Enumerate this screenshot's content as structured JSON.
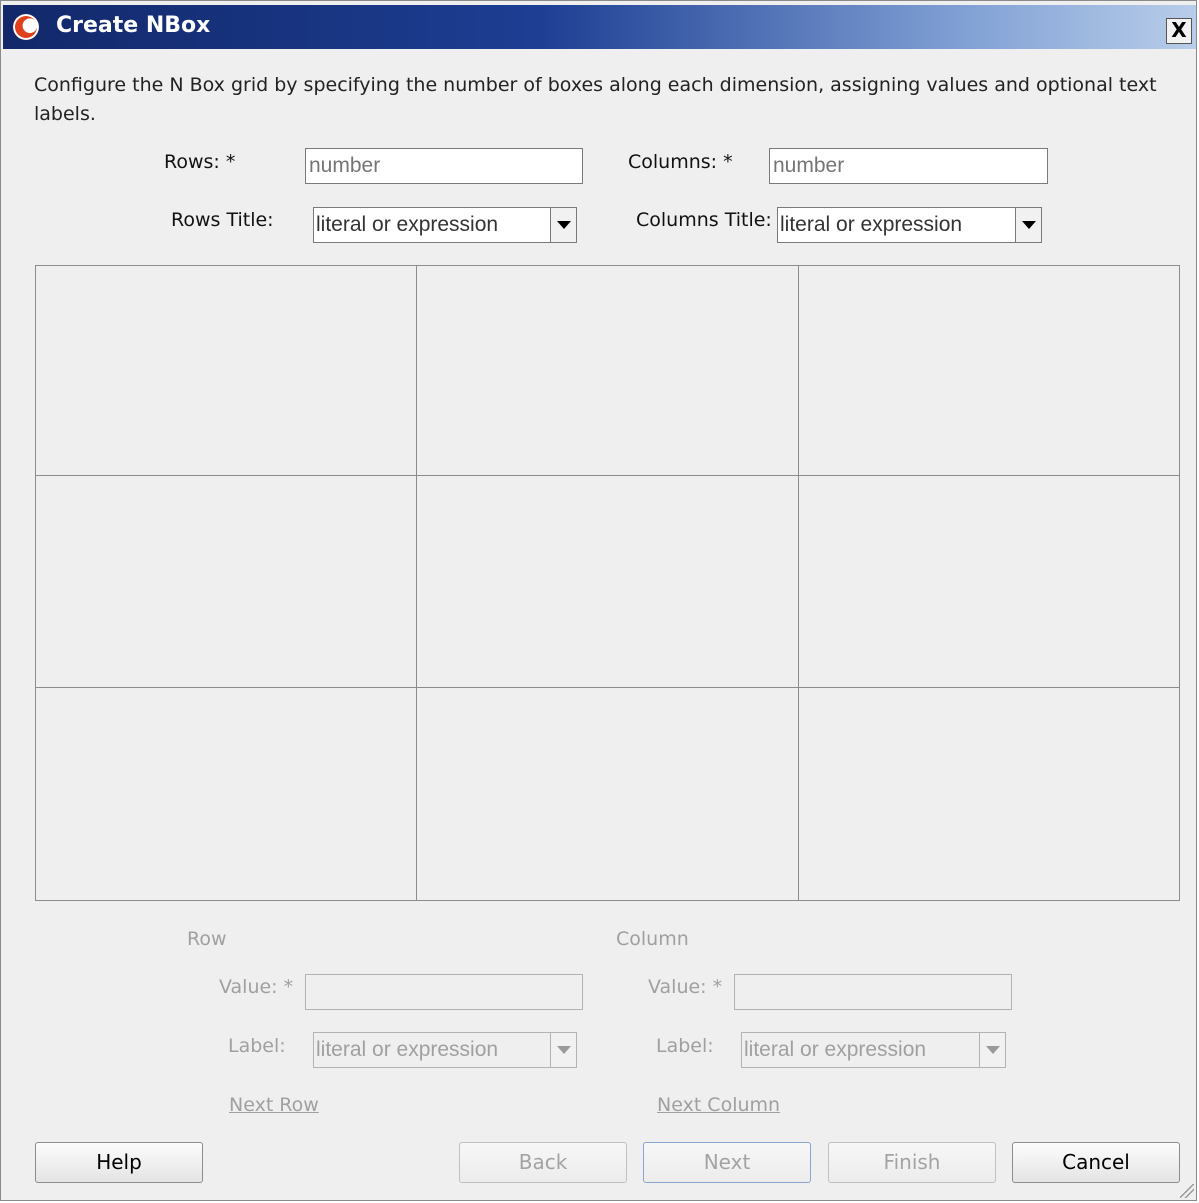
{
  "window": {
    "title": "Create NBox",
    "close_label": "X"
  },
  "description": "Configure the N Box grid by specifying the number of boxes along each dimension, assigning values and optional text labels.",
  "rows": {
    "label": "Rows: *",
    "placeholder": "number"
  },
  "columns": {
    "label": "Columns: *",
    "placeholder": "number"
  },
  "rows_title": {
    "label": "Rows Title:",
    "value": "literal or expression"
  },
  "columns_title": {
    "label": "Columns Title:",
    "value": "literal or expression"
  },
  "grid": {
    "rows": 3,
    "columns": 3
  },
  "row_section": {
    "heading": "Row",
    "value_label": "Value: *",
    "value": "",
    "label_label": "Label:",
    "label_value": "literal or expression",
    "next_link": "Next Row"
  },
  "column_section": {
    "heading": "Column",
    "value_label": "Value: *",
    "value": "",
    "label_label": "Label:",
    "label_value": "literal or expression",
    "next_link": "Next Column"
  },
  "buttons": {
    "help": "Help",
    "back": "Back",
    "next": "Next",
    "finish": "Finish",
    "cancel": "Cancel"
  }
}
